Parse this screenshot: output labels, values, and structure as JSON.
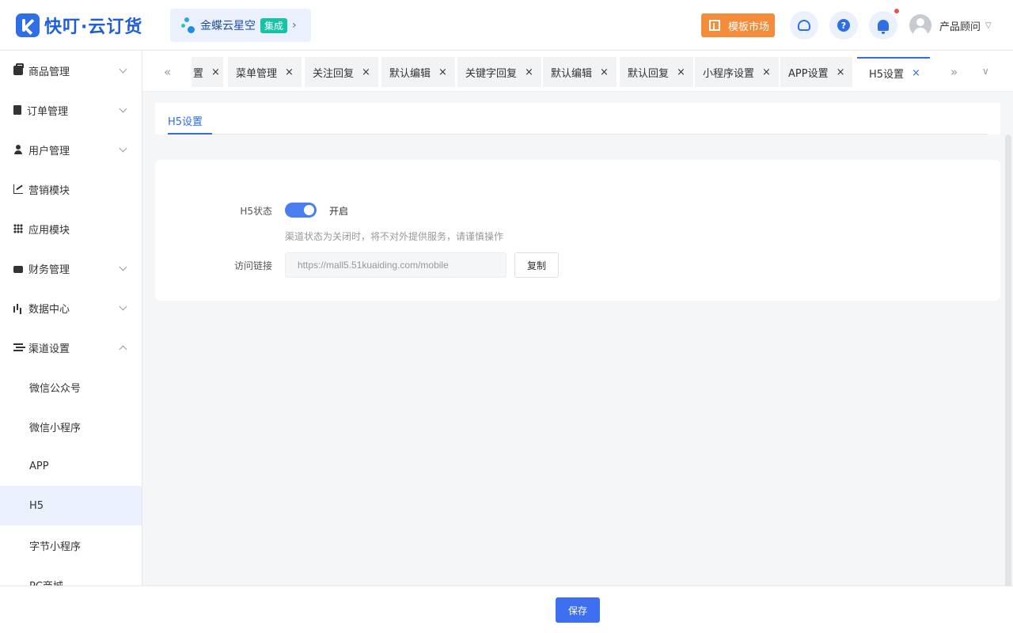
{
  "header": {
    "logo_text": "快叮·云订货",
    "kingdee": {
      "name": "金蝶云星空",
      "badge": "集成"
    },
    "market_label": "模板市场",
    "user_name": "产品顾问"
  },
  "sidebar": {
    "menus": [
      {
        "label": "商品管理",
        "icon": "shopping-bag-icon",
        "chevron": "down"
      },
      {
        "label": "订单管理",
        "icon": "clipboard-icon",
        "chevron": "down"
      },
      {
        "label": "用户管理",
        "icon": "user-icon",
        "chevron": "down"
      },
      {
        "label": "营销模块",
        "icon": "trend-chart-icon",
        "chevron": ""
      },
      {
        "label": "应用模块",
        "icon": "grid-icon",
        "chevron": ""
      },
      {
        "label": "财务管理",
        "icon": "wallet-icon",
        "chevron": "down"
      },
      {
        "label": "数据中心",
        "icon": "bar-chart-icon",
        "chevron": "down"
      },
      {
        "label": "渠道设置",
        "icon": "list-icon",
        "chevron": "up"
      }
    ],
    "sub_items": [
      "微信公众号",
      "微信小程序",
      "APP",
      "H5",
      "字节小程序",
      "PC商城"
    ],
    "active_sub": "H5"
  },
  "tabs": {
    "items": [
      "置",
      "菜单管理",
      "关注回复",
      "默认编辑",
      "关键字回复",
      "默认编辑",
      "默认回复",
      "小程序设置",
      "APP设置",
      "H5设置"
    ],
    "active": "H5设置"
  },
  "content": {
    "subtab": "H5设置",
    "status_label": "H5状态",
    "switch_text": "开启",
    "switch_on": true,
    "hint": "渠道状态为关闭时，将不对外提供服务，请谨慎操作",
    "link_label": "访问链接",
    "link_value": "https://mall5.51kuaiding.com/mobile",
    "copy_label": "复制"
  },
  "footer": {
    "save_label": "保存"
  },
  "colors": {
    "primary": "#2f6ee5",
    "accent_orange": "#f58c3a",
    "badge_teal": "#15c3a6",
    "notification": "#f05050"
  }
}
